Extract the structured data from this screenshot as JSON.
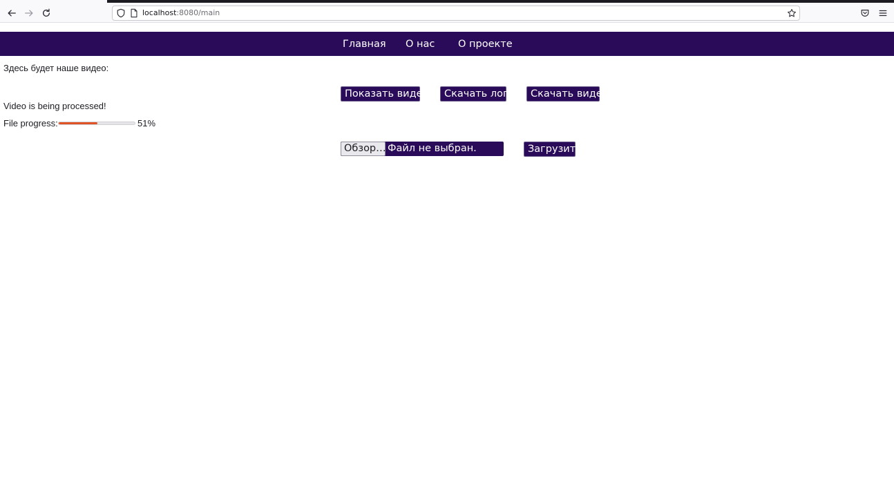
{
  "browser": {
    "url_host": "localhost",
    "url_path": ":8080/main"
  },
  "nav": {
    "items": [
      {
        "label": "Главная"
      },
      {
        "label": "О нас"
      },
      {
        "label": "О проекте"
      }
    ]
  },
  "main": {
    "intro_text": "Здесь будет наше видео:",
    "status_text": "Video is being processed!",
    "progress": {
      "label": "File progress:",
      "value_percent": 51,
      "display": "51%",
      "color": "#e05324"
    },
    "buttons": {
      "show_video": "Показать видео",
      "download_logs": "Скачать логи",
      "download_video": "Скачать видео",
      "upload": "Загрузить"
    },
    "file_input": {
      "browse_label": "Обзор…",
      "no_file_label": "Файл не выбран."
    }
  },
  "colors": {
    "brand": "#2a0b5a",
    "button_text": "#ffffff"
  },
  "icons": [
    "back-icon",
    "forward-icon",
    "reload-icon",
    "shield-icon",
    "page-icon",
    "star-icon",
    "pocket-icon",
    "menu-icon"
  ]
}
